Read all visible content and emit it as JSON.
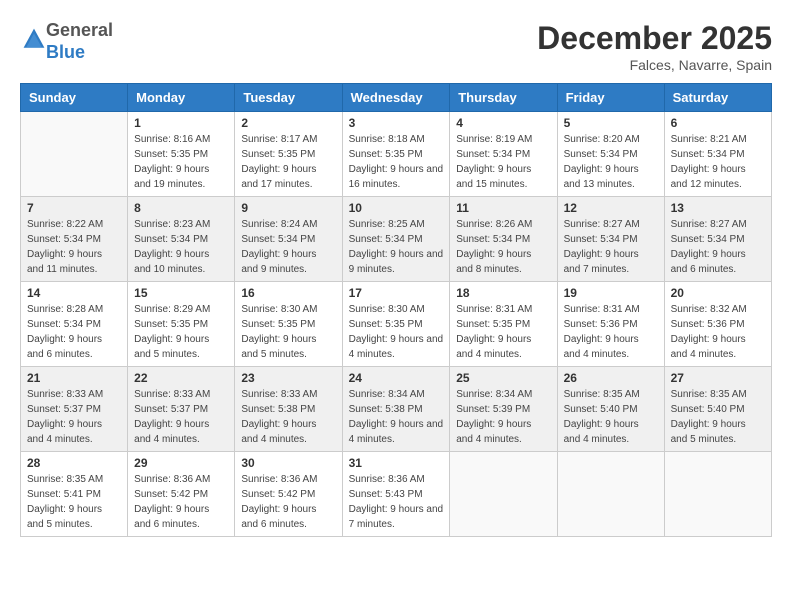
{
  "header": {
    "logo_general": "General",
    "logo_blue": "Blue",
    "month_title": "December 2025",
    "location": "Falces, Navarre, Spain"
  },
  "days_of_week": [
    "Sunday",
    "Monday",
    "Tuesday",
    "Wednesday",
    "Thursday",
    "Friday",
    "Saturday"
  ],
  "weeks": [
    [
      {
        "day": "",
        "sunrise": "",
        "sunset": "",
        "daylight": ""
      },
      {
        "day": "1",
        "sunrise": "Sunrise: 8:16 AM",
        "sunset": "Sunset: 5:35 PM",
        "daylight": "Daylight: 9 hours and 19 minutes."
      },
      {
        "day": "2",
        "sunrise": "Sunrise: 8:17 AM",
        "sunset": "Sunset: 5:35 PM",
        "daylight": "Daylight: 9 hours and 17 minutes."
      },
      {
        "day": "3",
        "sunrise": "Sunrise: 8:18 AM",
        "sunset": "Sunset: 5:35 PM",
        "daylight": "Daylight: 9 hours and 16 minutes."
      },
      {
        "day": "4",
        "sunrise": "Sunrise: 8:19 AM",
        "sunset": "Sunset: 5:34 PM",
        "daylight": "Daylight: 9 hours and 15 minutes."
      },
      {
        "day": "5",
        "sunrise": "Sunrise: 8:20 AM",
        "sunset": "Sunset: 5:34 PM",
        "daylight": "Daylight: 9 hours and 13 minutes."
      },
      {
        "day": "6",
        "sunrise": "Sunrise: 8:21 AM",
        "sunset": "Sunset: 5:34 PM",
        "daylight": "Daylight: 9 hours and 12 minutes."
      }
    ],
    [
      {
        "day": "7",
        "sunrise": "Sunrise: 8:22 AM",
        "sunset": "Sunset: 5:34 PM",
        "daylight": "Daylight: 9 hours and 11 minutes."
      },
      {
        "day": "8",
        "sunrise": "Sunrise: 8:23 AM",
        "sunset": "Sunset: 5:34 PM",
        "daylight": "Daylight: 9 hours and 10 minutes."
      },
      {
        "day": "9",
        "sunrise": "Sunrise: 8:24 AM",
        "sunset": "Sunset: 5:34 PM",
        "daylight": "Daylight: 9 hours and 9 minutes."
      },
      {
        "day": "10",
        "sunrise": "Sunrise: 8:25 AM",
        "sunset": "Sunset: 5:34 PM",
        "daylight": "Daylight: 9 hours and 9 minutes."
      },
      {
        "day": "11",
        "sunrise": "Sunrise: 8:26 AM",
        "sunset": "Sunset: 5:34 PM",
        "daylight": "Daylight: 9 hours and 8 minutes."
      },
      {
        "day": "12",
        "sunrise": "Sunrise: 8:27 AM",
        "sunset": "Sunset: 5:34 PM",
        "daylight": "Daylight: 9 hours and 7 minutes."
      },
      {
        "day": "13",
        "sunrise": "Sunrise: 8:27 AM",
        "sunset": "Sunset: 5:34 PM",
        "daylight": "Daylight: 9 hours and 6 minutes."
      }
    ],
    [
      {
        "day": "14",
        "sunrise": "Sunrise: 8:28 AM",
        "sunset": "Sunset: 5:34 PM",
        "daylight": "Daylight: 9 hours and 6 minutes."
      },
      {
        "day": "15",
        "sunrise": "Sunrise: 8:29 AM",
        "sunset": "Sunset: 5:35 PM",
        "daylight": "Daylight: 9 hours and 5 minutes."
      },
      {
        "day": "16",
        "sunrise": "Sunrise: 8:30 AM",
        "sunset": "Sunset: 5:35 PM",
        "daylight": "Daylight: 9 hours and 5 minutes."
      },
      {
        "day": "17",
        "sunrise": "Sunrise: 8:30 AM",
        "sunset": "Sunset: 5:35 PM",
        "daylight": "Daylight: 9 hours and 4 minutes."
      },
      {
        "day": "18",
        "sunrise": "Sunrise: 8:31 AM",
        "sunset": "Sunset: 5:35 PM",
        "daylight": "Daylight: 9 hours and 4 minutes."
      },
      {
        "day": "19",
        "sunrise": "Sunrise: 8:31 AM",
        "sunset": "Sunset: 5:36 PM",
        "daylight": "Daylight: 9 hours and 4 minutes."
      },
      {
        "day": "20",
        "sunrise": "Sunrise: 8:32 AM",
        "sunset": "Sunset: 5:36 PM",
        "daylight": "Daylight: 9 hours and 4 minutes."
      }
    ],
    [
      {
        "day": "21",
        "sunrise": "Sunrise: 8:33 AM",
        "sunset": "Sunset: 5:37 PM",
        "daylight": "Daylight: 9 hours and 4 minutes."
      },
      {
        "day": "22",
        "sunrise": "Sunrise: 8:33 AM",
        "sunset": "Sunset: 5:37 PM",
        "daylight": "Daylight: 9 hours and 4 minutes."
      },
      {
        "day": "23",
        "sunrise": "Sunrise: 8:33 AM",
        "sunset": "Sunset: 5:38 PM",
        "daylight": "Daylight: 9 hours and 4 minutes."
      },
      {
        "day": "24",
        "sunrise": "Sunrise: 8:34 AM",
        "sunset": "Sunset: 5:38 PM",
        "daylight": "Daylight: 9 hours and 4 minutes."
      },
      {
        "day": "25",
        "sunrise": "Sunrise: 8:34 AM",
        "sunset": "Sunset: 5:39 PM",
        "daylight": "Daylight: 9 hours and 4 minutes."
      },
      {
        "day": "26",
        "sunrise": "Sunrise: 8:35 AM",
        "sunset": "Sunset: 5:40 PM",
        "daylight": "Daylight: 9 hours and 4 minutes."
      },
      {
        "day": "27",
        "sunrise": "Sunrise: 8:35 AM",
        "sunset": "Sunset: 5:40 PM",
        "daylight": "Daylight: 9 hours and 5 minutes."
      }
    ],
    [
      {
        "day": "28",
        "sunrise": "Sunrise: 8:35 AM",
        "sunset": "Sunset: 5:41 PM",
        "daylight": "Daylight: 9 hours and 5 minutes."
      },
      {
        "day": "29",
        "sunrise": "Sunrise: 8:36 AM",
        "sunset": "Sunset: 5:42 PM",
        "daylight": "Daylight: 9 hours and 6 minutes."
      },
      {
        "day": "30",
        "sunrise": "Sunrise: 8:36 AM",
        "sunset": "Sunset: 5:42 PM",
        "daylight": "Daylight: 9 hours and 6 minutes."
      },
      {
        "day": "31",
        "sunrise": "Sunrise: 8:36 AM",
        "sunset": "Sunset: 5:43 PM",
        "daylight": "Daylight: 9 hours and 7 minutes."
      },
      {
        "day": "",
        "sunrise": "",
        "sunset": "",
        "daylight": ""
      },
      {
        "day": "",
        "sunrise": "",
        "sunset": "",
        "daylight": ""
      },
      {
        "day": "",
        "sunrise": "",
        "sunset": "",
        "daylight": ""
      }
    ]
  ]
}
